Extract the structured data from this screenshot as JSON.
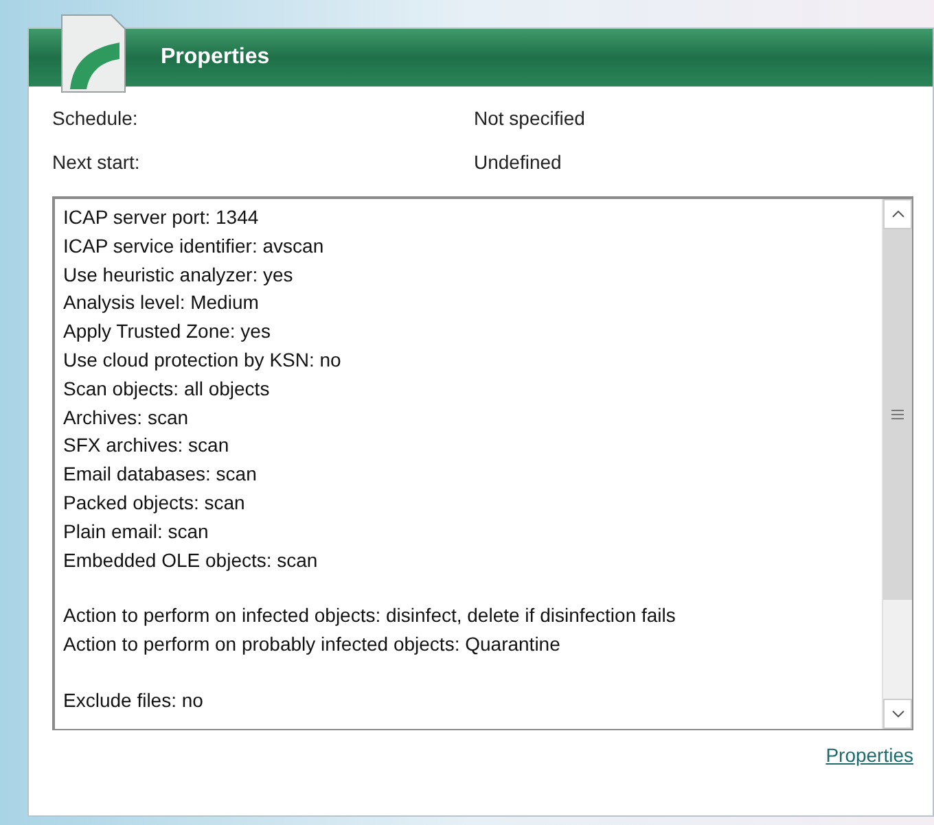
{
  "panel": {
    "title": "Properties"
  },
  "fields": [
    {
      "label": "Schedule:",
      "value": "Not specified"
    },
    {
      "label": "Next start:",
      "value": "Undefined"
    }
  ],
  "settings_groups": [
    [
      "ICAP server port: 1344",
      "ICAP service identifier: avscan",
      "Use heuristic analyzer: yes",
      "Analysis level: Medium",
      "Apply Trusted Zone: yes",
      "Use cloud protection by KSN: no",
      "Scan objects: all objects",
      "Archives: scan",
      "SFX archives: scan",
      "Email databases: scan",
      "Packed objects: scan",
      "Plain email: scan",
      "Embedded OLE objects: scan"
    ],
    [
      "Action to perform on infected objects: disinfect, delete if disinfection fails",
      "Action to perform on probably infected objects: Quarantine"
    ],
    [
      "Exclude files: no"
    ]
  ],
  "link": "Properties"
}
